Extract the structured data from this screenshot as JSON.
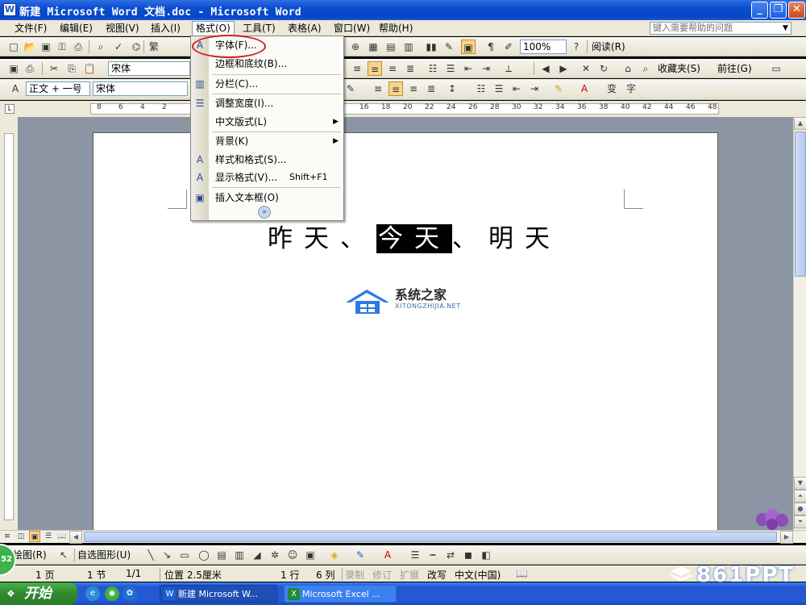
{
  "window": {
    "title": "新建 Microsoft Word 文档.doc - Microsoft Word",
    "app_icon": "W",
    "controls": [
      "_",
      "❐",
      "✕"
    ]
  },
  "menubar": {
    "items": [
      "文件(F)",
      "编辑(E)",
      "视图(V)",
      "插入(I)",
      "格式(O)",
      "工具(T)",
      "表格(A)",
      "窗口(W)",
      "帮助(H)"
    ],
    "help_placeholder": "键入需要帮助的问题"
  },
  "toolbar1": {
    "zoom": "100%",
    "read_label": "阅读(R)"
  },
  "toolbar2": {
    "font_combo": "宋体",
    "favorites": "收藏夹(S)",
    "forward": "前往(G)"
  },
  "toolbar3": {
    "style": "正文 + 一号",
    "font": "宋体"
  },
  "ruler": {
    "h_left": [
      "8",
      "6",
      "4",
      "2"
    ],
    "h_right": [
      "16",
      "18",
      "20",
      "22",
      "24",
      "26",
      "28",
      "30",
      "32",
      "34",
      "36",
      "38",
      "40",
      "42",
      "44",
      "46",
      "48"
    ]
  },
  "format_menu": {
    "items": [
      {
        "label": "字体(F)...",
        "icon": "A"
      },
      {
        "label": "边框和底纹(B)...",
        "icon": ""
      },
      {
        "label": "分栏(C)...",
        "icon": "▥"
      },
      {
        "label": "调整宽度(I)...",
        "icon": "☰"
      },
      {
        "label": "中文版式(L)",
        "icon": "",
        "submenu": true
      },
      {
        "label": "背景(K)",
        "icon": "",
        "submenu": true
      },
      {
        "label": "样式和格式(S)...",
        "icon": "A"
      },
      {
        "label": "显示格式(V)...",
        "icon": "A",
        "shortcut": "Shift+F1"
      },
      {
        "label": "插入文本框(O)",
        "icon": "▣"
      }
    ]
  },
  "document": {
    "before": "昨天、",
    "selected": "今天",
    "after": "、明天"
  },
  "watermark": {
    "title": "系统之家",
    "sub": "XITONGZHIJIA.NET"
  },
  "drawbar": {
    "draw": "绘图(R)",
    "autoshapes": "自选图形(U)"
  },
  "status": {
    "page": "1 页",
    "section": "1 节",
    "pages": "1/1",
    "position": "位置 2.5厘米",
    "line": "1 行",
    "col": "6 列",
    "rec": "录制",
    "trk": "修订",
    "ext": "扩展",
    "ovr": "改写",
    "lang": "中文(中国)"
  },
  "taskbar": {
    "start": "开始",
    "tasks": [
      "新建 Microsoft W...",
      "Microsoft Excel ..."
    ]
  },
  "badge": "52",
  "brand": "861PPT",
  "colors": {
    "titlebar": "#0a4cd0",
    "chrome": "#ece9d8",
    "document_bg": "#8c95a3",
    "highlight": "#d12020"
  }
}
